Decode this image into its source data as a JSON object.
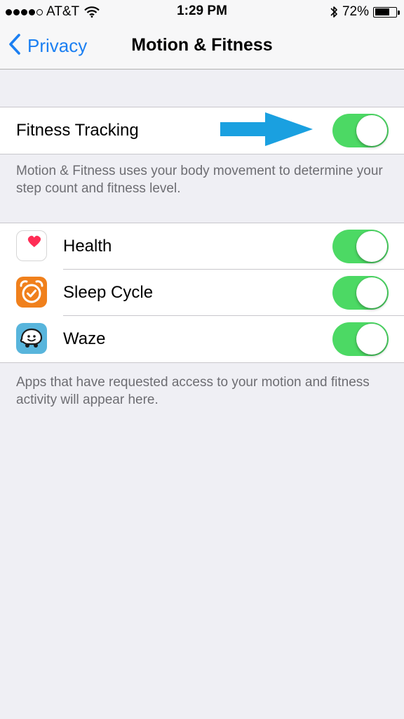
{
  "status_bar": {
    "carrier": "AT&T",
    "time": "1:29 PM",
    "battery_percent": "72%",
    "battery_level": 0.72,
    "signal_bars": 4,
    "icons": [
      "signal-dots-icon",
      "wifi-icon",
      "bluetooth-icon",
      "battery-icon"
    ]
  },
  "nav": {
    "back_label": "Privacy",
    "title": "Motion & Fitness"
  },
  "fitness_tracking": {
    "label": "Fitness Tracking",
    "enabled": true,
    "footer": "Motion & Fitness uses your body movement to determine your step count and fitness level."
  },
  "apps": {
    "items": [
      {
        "label": "Health",
        "icon": "health-heart-icon",
        "enabled": true
      },
      {
        "label": "Sleep Cycle",
        "icon": "alarm-clock-icon",
        "enabled": true
      },
      {
        "label": "Waze",
        "icon": "waze-icon",
        "enabled": true
      }
    ],
    "footer": "Apps that have requested access to your motion and fitness activity will appear here."
  },
  "colors": {
    "toggle_on": "#4cd964",
    "link_blue": "#1b7ff2",
    "annotation_arrow": "#1aa0e0",
    "background": "#efeff4"
  }
}
